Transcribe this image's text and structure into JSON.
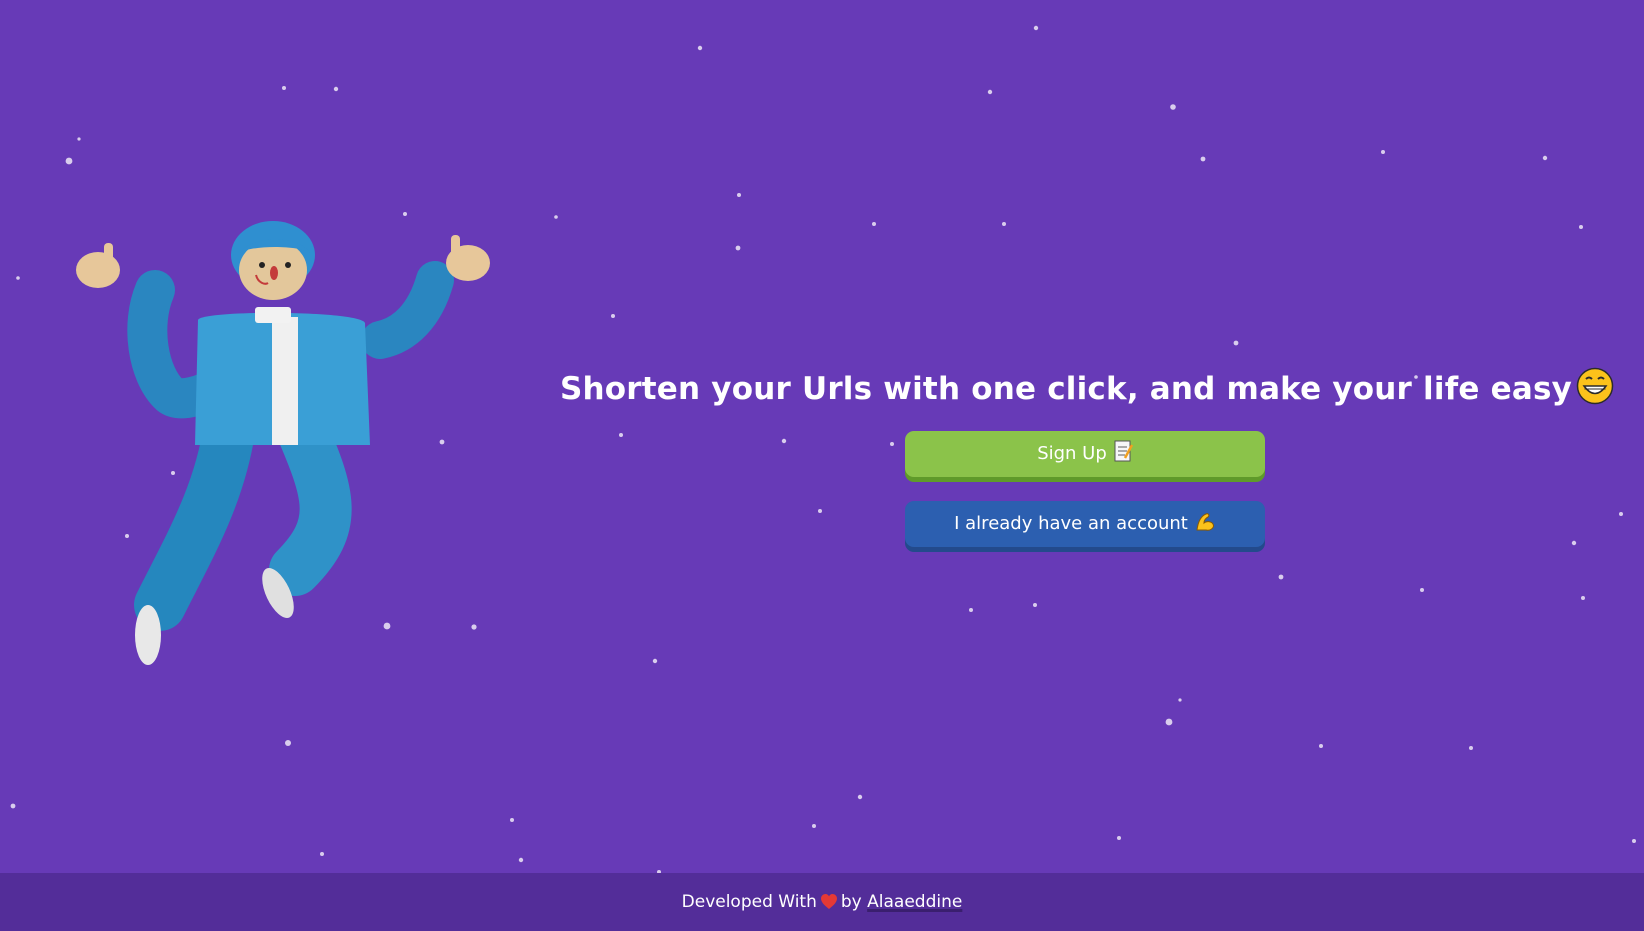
{
  "hero": {
    "headline": "Shorten your Urls with one click, and make your life easy",
    "headline_emoji": "grinning-face-icon"
  },
  "buttons": {
    "signup_label": "Sign Up",
    "signup_icon": "memo-icon",
    "login_label": "I already have an account",
    "login_icon": "flexed-biceps-icon"
  },
  "footer": {
    "prefix": "Developed With",
    "heart_icon": "heart-icon",
    "by": "by",
    "author": "Alaaeddine"
  },
  "illustration": {
    "icon": "jumping-man-illustration"
  },
  "colors": {
    "background": "#673ab7",
    "footer": "#532d99",
    "signup": "#8bc34a",
    "login": "#2c5fb0"
  }
}
